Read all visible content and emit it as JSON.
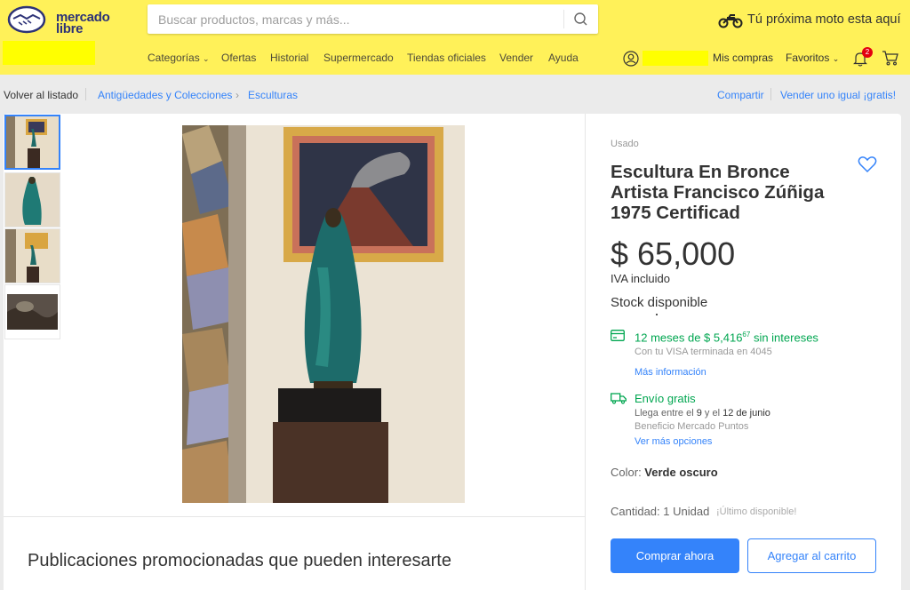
{
  "header": {
    "logo_text_line1": "mercado",
    "logo_text_line2": "libre",
    "search_placeholder": "Buscar productos, marcas y más...",
    "promo_text": "Tú próxima moto esta aquí",
    "nav": [
      "Categorías",
      "Ofertas",
      "Historial",
      "Supermercado",
      "Tiendas oficiales",
      "Vender",
      "Ayuda"
    ],
    "mis_compras": "Mis compras",
    "favoritos": "Favoritos",
    "notifications_count": "2"
  },
  "breadcrumb": {
    "back": "Volver al listado",
    "items": [
      "Antigüedades y Colecciones",
      "Esculturas"
    ],
    "share": "Compartir",
    "sell_same": "Vender uno igual ¡gratis!"
  },
  "product": {
    "condition": "Usado",
    "title": "Escultura En Bronce Artista Francisco Zúñiga 1975 Certificad",
    "price": "$ 65,000",
    "iva": "IVA incluido",
    "stock": "Stock disponible",
    "installments": "12 meses de $ 5,416",
    "installments_cents": "67",
    "installments_suffix": " sin intereses",
    "visa": "Con tu VISA terminada en 4045",
    "more_info": "Más información",
    "shipping": "Envío gratis",
    "arrives_prefix": "Llega entre el ",
    "arrives_from": "9",
    "arrives_mid": " y el ",
    "arrives_to": "12 de junio",
    "benefit": "Beneficio Mercado Puntos",
    "more_options": "Ver más opciones",
    "color_label": "Color: ",
    "color_value": "Verde oscuro",
    "quantity": "Cantidad: 1 Unidad",
    "last_available": "¡Último disponible!",
    "buy_now": "Comprar ahora",
    "add_to_cart": "Agregar al carrito"
  },
  "promoted": {
    "title": "Publicaciones promocionadas que pueden interesarte"
  },
  "colors": {
    "header_bg": "#fff159",
    "brand_blue": "#3483fa",
    "green": "#00a650"
  }
}
